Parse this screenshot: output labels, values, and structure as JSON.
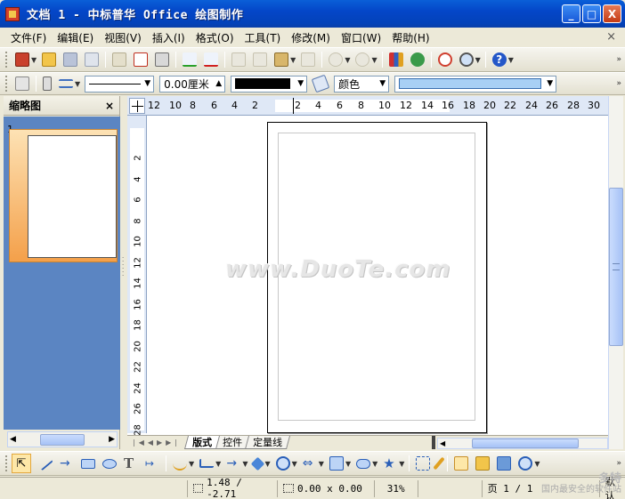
{
  "window": {
    "title": "文档 1 - 中标普华 Office 绘图制作",
    "minimize": "_",
    "maximize": "□",
    "close": "X"
  },
  "menu": {
    "items": [
      "文件(F)",
      "编辑(E)",
      "视图(V)",
      "插入(I)",
      "格式(O)",
      "工具(T)",
      "修改(M)",
      "窗口(W)",
      "帮助(H)"
    ],
    "close": "×"
  },
  "format_toolbar": {
    "line_width": "0.00厘米",
    "fill_label": "颜色"
  },
  "thumbnail_panel": {
    "title": "缩略图",
    "close": "×",
    "page_number": "1"
  },
  "ruler": {
    "h_labels": [
      "12",
      "10",
      "8",
      "6",
      "4",
      "2",
      "2",
      "4",
      "6",
      "8",
      "10",
      "12",
      "14",
      "16",
      "18",
      "20",
      "22",
      "24",
      "26",
      "28",
      "30"
    ],
    "v_labels": [
      "2",
      "4",
      "6",
      "8",
      "10",
      "12",
      "14",
      "16",
      "18",
      "20",
      "22",
      "24",
      "26",
      "28"
    ]
  },
  "canvas": {
    "watermark": "www.DuoTe.com"
  },
  "tabs": {
    "items": [
      "版式",
      "控件",
      "定量线"
    ],
    "active": "版式"
  },
  "status": {
    "position": "1.48 / -2.71",
    "size": "0.00 x 0.00",
    "zoom": "31%",
    "page": "页 1 / 1",
    "mode": "默认"
  },
  "corner_watermark": {
    "line1": "多特",
    "line2": "国内最安全的软件站"
  }
}
